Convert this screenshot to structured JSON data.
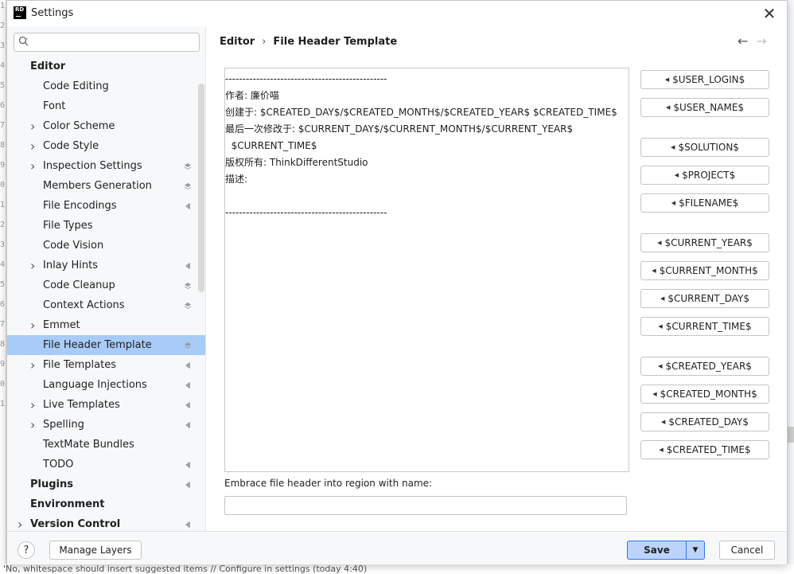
{
  "window": {
    "title": "Settings",
    "app_logo_text": "RD"
  },
  "background": {
    "gutter_numbers": [
      "1",
      "2",
      "3",
      "4",
      "5",
      "6",
      "7",
      "8",
      "9",
      "0",
      "1",
      "2",
      "3",
      "4",
      "5",
      "6",
      "7",
      "8",
      "9",
      "0",
      "1"
    ],
    "bottom_text": "'No, whitespace should insert suggested items // Configure in settings (today 4:40)"
  },
  "search": {
    "placeholder": "",
    "value": ""
  },
  "sidebar": {
    "items": [
      {
        "label": "Editor",
        "level": 0,
        "expandable": false,
        "marker": ""
      },
      {
        "label": "Code Editing",
        "level": 1,
        "expandable": false,
        "marker": ""
      },
      {
        "label": "Font",
        "level": 1,
        "expandable": false,
        "marker": ""
      },
      {
        "label": "Color Scheme",
        "level": 1,
        "expandable": true,
        "marker": ""
      },
      {
        "label": "Code Style",
        "level": 1,
        "expandable": true,
        "marker": ""
      },
      {
        "label": "Inspection Settings",
        "level": 1,
        "expandable": true,
        "marker": "layers"
      },
      {
        "label": "Members Generation",
        "level": 1,
        "expandable": false,
        "marker": "layers"
      },
      {
        "label": "File Encodings",
        "level": 1,
        "expandable": false,
        "marker": "project"
      },
      {
        "label": "File Types",
        "level": 1,
        "expandable": false,
        "marker": ""
      },
      {
        "label": "Code Vision",
        "level": 1,
        "expandable": false,
        "marker": ""
      },
      {
        "label": "Inlay Hints",
        "level": 1,
        "expandable": true,
        "marker": "project"
      },
      {
        "label": "Code Cleanup",
        "level": 1,
        "expandable": false,
        "marker": "layers"
      },
      {
        "label": "Context Actions",
        "level": 1,
        "expandable": false,
        "marker": "layers"
      },
      {
        "label": "Emmet",
        "level": 1,
        "expandable": true,
        "marker": ""
      },
      {
        "label": "File Header Template",
        "level": 1,
        "expandable": false,
        "marker": "layers",
        "selected": true
      },
      {
        "label": "File Templates",
        "level": 1,
        "expandable": true,
        "marker": "project"
      },
      {
        "label": "Language Injections",
        "level": 1,
        "expandable": false,
        "marker": "project"
      },
      {
        "label": "Live Templates",
        "level": 1,
        "expandable": true,
        "marker": "project"
      },
      {
        "label": "Spelling",
        "level": 1,
        "expandable": true,
        "marker": "project"
      },
      {
        "label": "TextMate Bundles",
        "level": 1,
        "expandable": false,
        "marker": ""
      },
      {
        "label": "TODO",
        "level": 1,
        "expandable": false,
        "marker": "project"
      },
      {
        "label": "Plugins",
        "level": 0,
        "expandable": false,
        "marker": "project"
      },
      {
        "label": "Environment",
        "level": 0,
        "expandable": false,
        "marker": ""
      },
      {
        "label": "Version Control",
        "level": 0,
        "expandable": true,
        "marker": "project"
      }
    ]
  },
  "breadcrumb": {
    "parent": "Editor",
    "separator": "›",
    "current": "File Header Template"
  },
  "nav": {
    "back_icon": "arrow-left-icon",
    "forward_icon": "arrow-right-icon"
  },
  "template_lines": [
    "-----------------------------------------------",
    "作者: 廉价喵",
    "创建于: $CREATED_DAY$/$CREATED_MONTH$/$CREATED_YEAR$ $CREATED_TIME$",
    "最后一次修改于: $CURRENT_DAY$/$CURRENT_MONTH$/$CURRENT_YEAR$",
    "  $CURRENT_TIME$",
    "版权所有: ThinkDifferentStudio",
    "描述:",
    "",
    "-----------------------------------------------"
  ],
  "macros": [
    {
      "label": "$USER_LOGIN$",
      "group": 0
    },
    {
      "label": "$USER_NAME$",
      "group": 0
    },
    {
      "label": "$SOLUTION$",
      "group": 1
    },
    {
      "label": "$PROJECT$",
      "group": 1
    },
    {
      "label": "$FILENAME$",
      "group": 1
    },
    {
      "label": "$CURRENT_YEAR$",
      "group": 2
    },
    {
      "label": "$CURRENT_MONTH$",
      "group": 2
    },
    {
      "label": "$CURRENT_DAY$",
      "group": 2
    },
    {
      "label": "$CURRENT_TIME$",
      "group": 2
    },
    {
      "label": "$CREATED_YEAR$",
      "group": 3
    },
    {
      "label": "$CREATED_MONTH$",
      "group": 3
    },
    {
      "label": "$CREATED_DAY$",
      "group": 3
    },
    {
      "label": "$CREATED_TIME$",
      "group": 3
    }
  ],
  "region": {
    "label": "Embrace file header into region with name:",
    "value": ""
  },
  "footer": {
    "help_label": "?",
    "manage_layers_label": "Manage Layers",
    "save_label": "Save",
    "save_dropdown_icon": "chevron-down-icon",
    "cancel_label": "Cancel"
  },
  "colors": {
    "selection": "#a8cbf7",
    "primary_border": "#3574f0",
    "primary_fill": "#bcd4fb"
  }
}
